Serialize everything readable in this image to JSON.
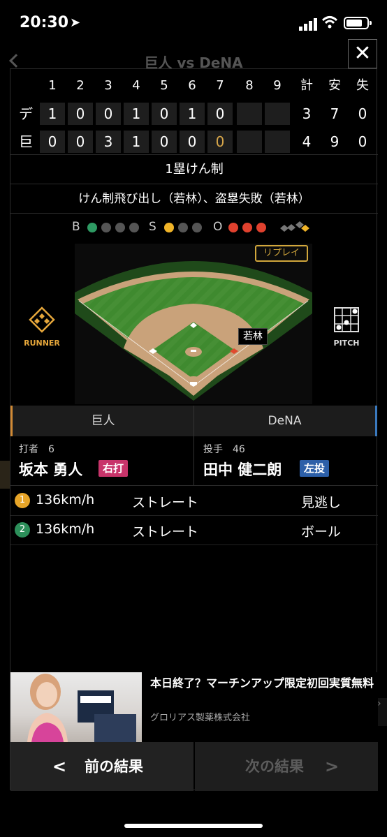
{
  "status_bar": {
    "time": "20:30"
  },
  "background": {
    "title": "巨人 vs DeNA"
  },
  "scoreboard": {
    "headers": [
      "1",
      "2",
      "3",
      "4",
      "5",
      "6",
      "7",
      "8",
      "9",
      "計",
      "安",
      "失"
    ],
    "rows": [
      {
        "team": "デ",
        "innings": [
          "1",
          "0",
          "0",
          "1",
          "0",
          "1",
          "0",
          "",
          ""
        ],
        "totals": [
          "3",
          "7",
          "0"
        ]
      },
      {
        "team": "巨",
        "innings": [
          "0",
          "0",
          "3",
          "1",
          "0",
          "0",
          "0",
          "",
          ""
        ],
        "totals": [
          "4",
          "9",
          "0"
        ]
      }
    ]
  },
  "play": {
    "title": "1塁けん制",
    "description": "けん制飛び出し（若林）、盗塁失敗（若林）"
  },
  "count": {
    "ball_label": "B",
    "balls": 1,
    "strike_label": "S",
    "strikes": 1,
    "out_label": "O",
    "outs": 3
  },
  "field": {
    "replay_label": "リプレイ",
    "runner_label": "RUNNER",
    "pitch_label": "PITCH",
    "runner_name": "若林"
  },
  "teams": {
    "home": "巨人",
    "away": "DeNA"
  },
  "batter": {
    "role": "打者　6",
    "name": "坂本 勇人",
    "hand": "右打"
  },
  "pitcher": {
    "role": "投手　46",
    "name": "田中 健二朗",
    "hand": "左投"
  },
  "pitches": [
    {
      "no": "1",
      "speed": "136km/h",
      "type": "ストレート",
      "result": "見逃し",
      "color": "#e7a528"
    },
    {
      "no": "2",
      "speed": "136km/h",
      "type": "ストレート",
      "result": "ボール",
      "color": "#2c8f5a"
    }
  ],
  "ad": {
    "title": "本日終了？マーチンアップ限定初回実質無料",
    "sponsor": "グロリアス製薬株式会社"
  },
  "nav": {
    "prev": "前の結果",
    "next": "次の結果"
  },
  "colors": {
    "ball": "#2e9a63",
    "strike": "#f0b428",
    "out": "#e0412e",
    "accent": "#d2a73c"
  }
}
